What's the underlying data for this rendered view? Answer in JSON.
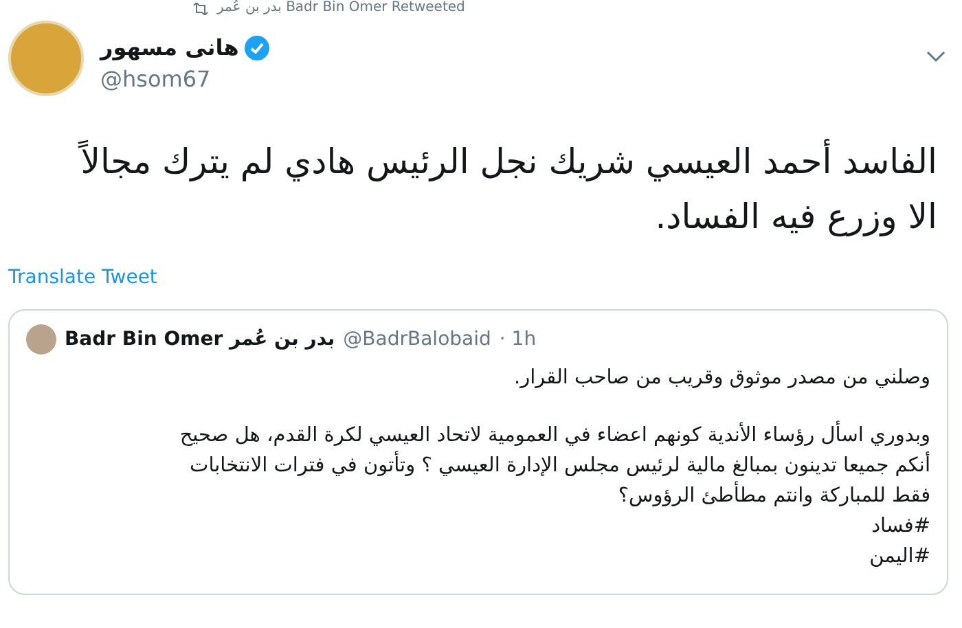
{
  "retweet_banner": {
    "text": "بدر بن عُمر Badr Bin Omer Retweeted"
  },
  "tweet": {
    "author_name": "هانى مسهور",
    "verified": true,
    "handle": "@hsom67",
    "text": "الفاسد أحمد العيسي شريك نجل الرئيس هادي لم يترك مجالاً\nالا وزرع فيه الفساد.",
    "translate_link": "Translate Tweet"
  },
  "quoted_tweet": {
    "author_name": "Badr Bin Omer بدر بن عُمر",
    "handle": "@BadrBalobaid",
    "time": "· 1h",
    "paragraphs": [
      "وصلني من مصدر موثوق وقريب من صاحب القرار.",
      "وبدوري اسأل رؤساء الأندية كونهم اعضاء في العمومية لاتحاد العيسي لكرة القدم، هل صحيح\nأنكم جميعا تدينون بمبالغ مالية لرئيس مجلس الإدارة العيسي ؟ وتأتون في فترات الانتخابات\nفقط للمباركة وانتم مطأطئ الرؤوس؟\n#فساد\n#اليمن"
    ]
  }
}
